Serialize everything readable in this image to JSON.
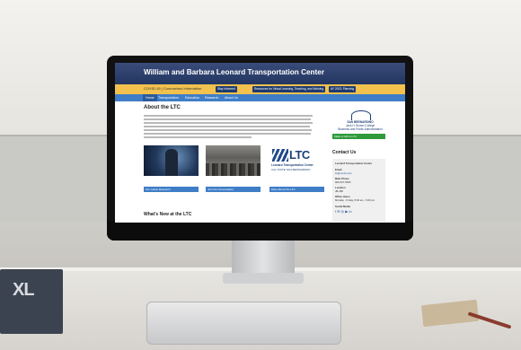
{
  "site": {
    "title": "William and Barbara Leonard Transportation Center",
    "alert": {
      "text": "COVID-19 | Coronavirus Information",
      "buttons": [
        "Stay Informed",
        "Resources for Virtual Learning, Teaching, and Working",
        "AY 20/21 Planning"
      ]
    },
    "nav": {
      "items": [
        "Home",
        "Transportation",
        "Education",
        "Research",
        "About Us"
      ]
    },
    "about": {
      "title": "About the LTC"
    },
    "cards": [
      {
        "caption": "Our Latest Research"
      },
      {
        "caption": "Join the Conversation"
      },
      {
        "caption": "More About the LTC"
      }
    ],
    "ltc_logo": {
      "mark": "LTC",
      "name": "Leonard Transportation Center",
      "university": "CAL STATE SAN BERNARDINO"
    },
    "whats_new": "What's New at the LTC",
    "sidebar": {
      "university": "SAN BERNARDINO",
      "college": "Jack H. Brown College",
      "college_sub": "Business and Public Administration",
      "green_button": "Make a Gift to LTC",
      "contact_title": "Contact Us",
      "contact_items": [
        {
          "label": "Leonard Transportation Center",
          "bold": true
        },
        {
          "label": "Email",
          "bold": true
        },
        {
          "label": "ltc@csusb.edu",
          "link": true
        },
        {
          "label": "Main Phone",
          "bold": true
        },
        {
          "label": "909-537-5565"
        },
        {
          "label": "Location",
          "bold": true
        },
        {
          "label": "JB-298"
        },
        {
          "label": "Office Hours",
          "bold": true
        },
        {
          "label": "Monday - Friday, 8:00 am - 5:00 pm"
        },
        {
          "label": "Social Media",
          "bold": true
        },
        {
          "label": "f ✉ ◎ ▶ in"
        }
      ]
    }
  },
  "scene": {
    "book_label": "XL"
  }
}
